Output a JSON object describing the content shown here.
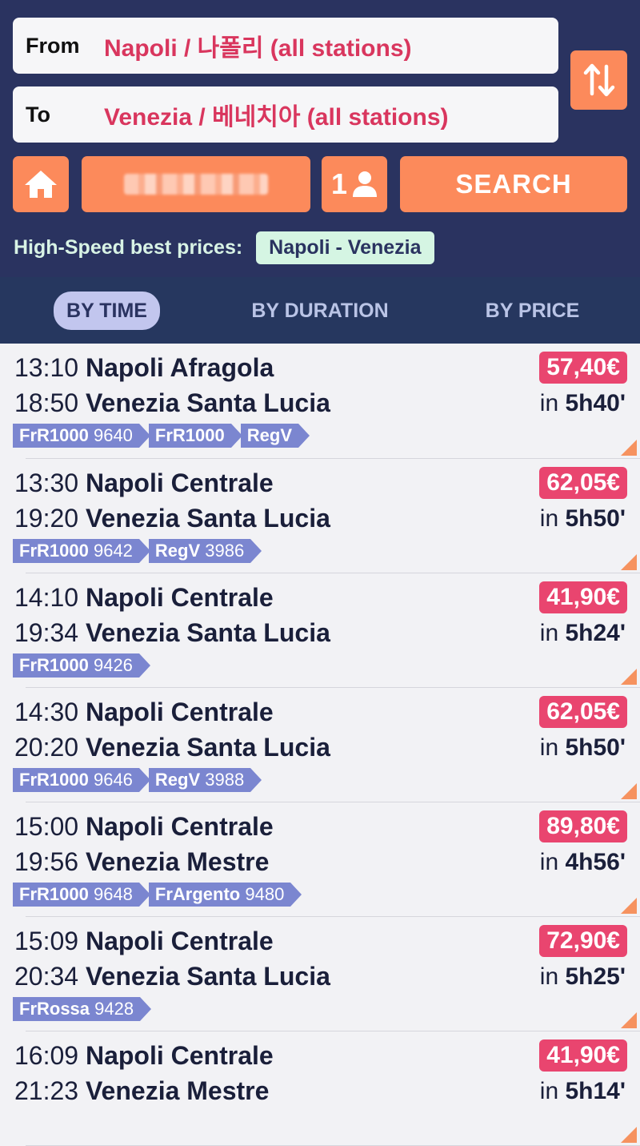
{
  "search": {
    "from_label": "From",
    "from_value": "Napoli / 나폴리 (all stations)",
    "to_label": "To",
    "to_value": "Venezia / 베네치아 (all stations)",
    "passengers": "1",
    "search_label": "SEARCH",
    "best_label": "High-Speed best prices:",
    "best_route": "Napoli - Venezia"
  },
  "tabs": [
    {
      "label": "BY TIME",
      "active": true
    },
    {
      "label": "BY DURATION",
      "active": false
    },
    {
      "label": "BY PRICE",
      "active": false
    }
  ],
  "trains": [
    {
      "dep_time": "13:10",
      "dep_station": "Napoli Afragola",
      "arr_time": "18:50",
      "arr_station": "Venezia Santa Lucia",
      "price": "57,40€",
      "dur_prefix": "in",
      "duration": "5h40'",
      "tags": [
        {
          "name": "FrR1000",
          "num": "9640"
        },
        {
          "name": "FrR1000",
          "num": ""
        },
        {
          "name": "RegV",
          "num": ""
        }
      ]
    },
    {
      "dep_time": "13:30",
      "dep_station": "Napoli Centrale",
      "arr_time": "19:20",
      "arr_station": "Venezia Santa Lucia",
      "price": "62,05€",
      "dur_prefix": "in",
      "duration": "5h50'",
      "tags": [
        {
          "name": "FrR1000",
          "num": "9642"
        },
        {
          "name": "RegV",
          "num": "3986"
        }
      ]
    },
    {
      "dep_time": "14:10",
      "dep_station": "Napoli Centrale",
      "arr_time": "19:34",
      "arr_station": "Venezia Santa Lucia",
      "price": "41,90€",
      "dur_prefix": "in",
      "duration": "5h24'",
      "tags": [
        {
          "name": "FrR1000",
          "num": "9426"
        }
      ]
    },
    {
      "dep_time": "14:30",
      "dep_station": "Napoli Centrale",
      "arr_time": "20:20",
      "arr_station": "Venezia Santa Lucia",
      "price": "62,05€",
      "dur_prefix": "in",
      "duration": "5h50'",
      "tags": [
        {
          "name": "FrR1000",
          "num": "9646"
        },
        {
          "name": "RegV",
          "num": "3988"
        }
      ]
    },
    {
      "dep_time": "15:00",
      "dep_station": "Napoli Centrale",
      "arr_time": "19:56",
      "arr_station": "Venezia Mestre",
      "price": "89,80€",
      "dur_prefix": "in",
      "duration": "4h56'",
      "tags": [
        {
          "name": "FrR1000",
          "num": "9648"
        },
        {
          "name": "FrArgento",
          "num": "9480"
        }
      ]
    },
    {
      "dep_time": "15:09",
      "dep_station": "Napoli Centrale",
      "arr_time": "20:34",
      "arr_station": "Venezia Santa Lucia",
      "price": "72,90€",
      "dur_prefix": "in",
      "duration": "5h25'",
      "tags": [
        {
          "name": "FrRossa",
          "num": "9428"
        }
      ]
    },
    {
      "dep_time": "16:09",
      "dep_station": "Napoli Centrale",
      "arr_time": "21:23",
      "arr_station": "Venezia Mestre",
      "price": "41,90€",
      "dur_prefix": "in",
      "duration": "5h14'",
      "tags": []
    }
  ]
}
